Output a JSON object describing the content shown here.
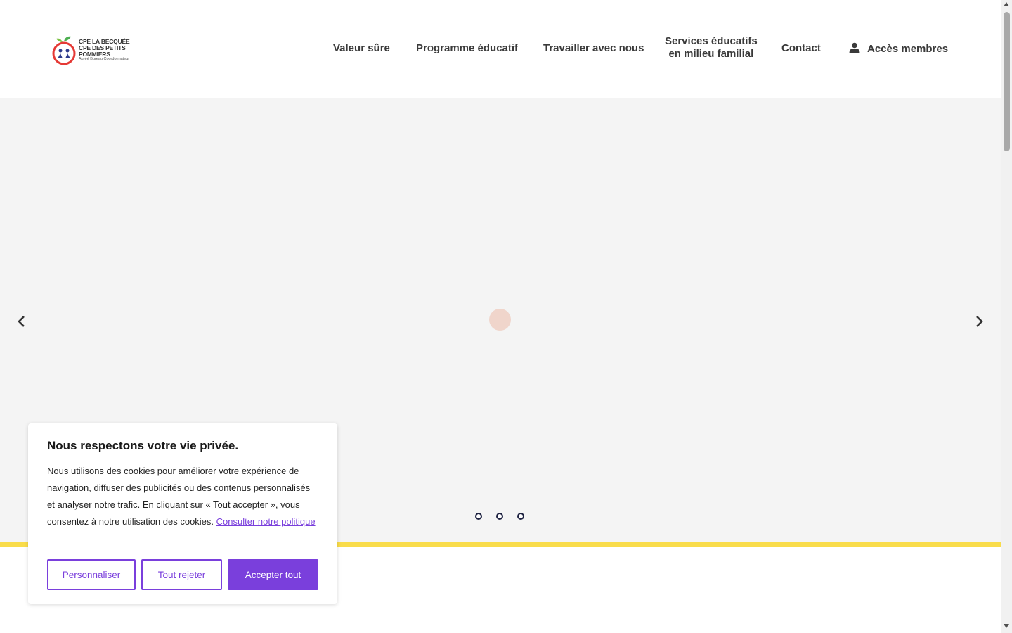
{
  "logo": {
    "line1": "CPE LA BECQUÉE",
    "line2": "CPE DES PETITS POMMIERS",
    "line3": "Agréé Bureau Coordonnateur"
  },
  "nav": {
    "items": [
      {
        "label": "Valeur sûre"
      },
      {
        "label": "Programme éducatif"
      },
      {
        "label": "Travailler avec nous"
      },
      {
        "label_line1": "Services éducatifs",
        "label_line2": "en milieu familial"
      },
      {
        "label": "Contact"
      },
      {
        "label": "Accès membres",
        "icon": "user-icon"
      }
    ]
  },
  "slider": {
    "slide_count": 3,
    "active_slide": null,
    "loading": true
  },
  "cookie_banner": {
    "title": "Nous respectons votre vie privée.",
    "text": "Nous utilisons des cookies pour améliorer votre expérience de navigation, diffuser des publicités ou des contenus personnalisés et analyser notre trafic. En cliquant sur « Tout accepter », vous consentez à notre utilisation des cookies.",
    "link": "Consulter notre politique",
    "buttons": {
      "customize": "Personnaliser",
      "reject": "Tout rejeter",
      "accept": "Accepter tout"
    }
  },
  "colors": {
    "accent": "#7a3fdc",
    "yellow_bar": "#f9dc4a",
    "hero_bg": "#f4f4f4",
    "dot_border": "#1d2140"
  }
}
